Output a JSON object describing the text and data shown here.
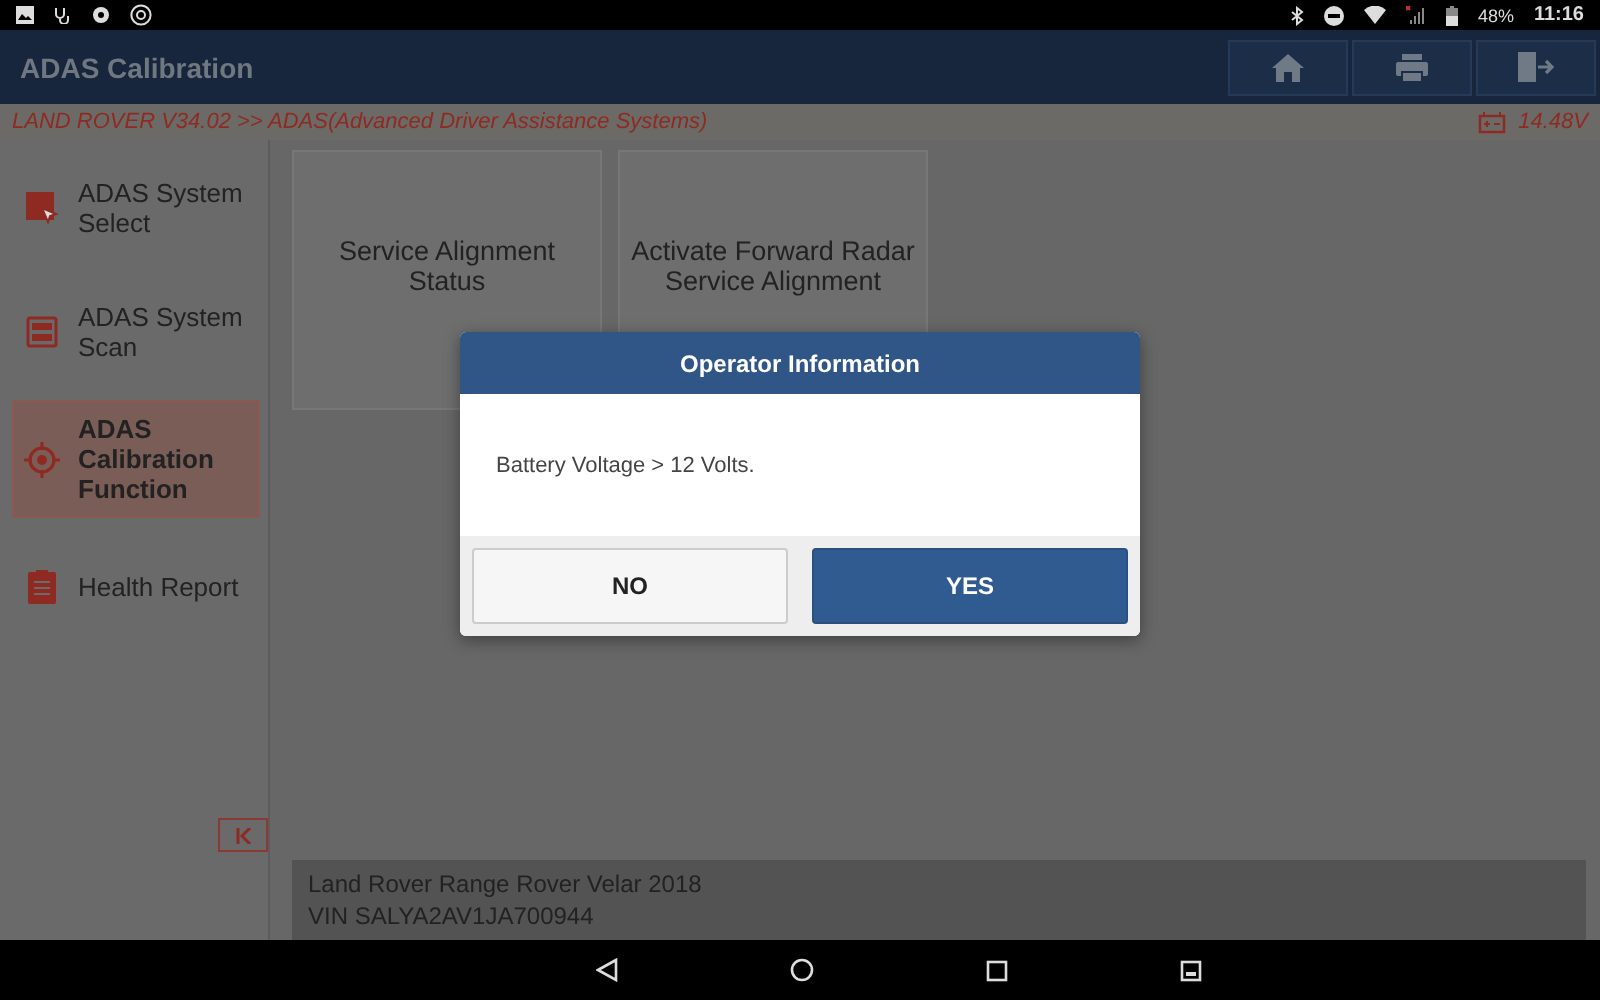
{
  "status_bar": {
    "battery": "48%",
    "time": "11:16"
  },
  "header": {
    "title": "ADAS Calibration"
  },
  "breadcrumb": {
    "path": "LAND ROVER V34.02 >> ADAS(Advanced Driver Assistance Systems)",
    "voltage": "14.48V"
  },
  "sidebar": {
    "items": [
      {
        "label": "ADAS System Select",
        "kind": "select",
        "selected": false
      },
      {
        "label": "ADAS System Scan",
        "kind": "scan",
        "selected": false
      },
      {
        "label": "ADAS Calibration Function",
        "kind": "target",
        "selected": true
      },
      {
        "label": "Health Report",
        "kind": "report",
        "selected": false
      }
    ]
  },
  "tiles": [
    "Service Alignment Status",
    "Activate Forward Radar Service Alignment"
  ],
  "vehicle": {
    "model": "Land Rover Range Rover Velar 2018",
    "vin": "VIN SALYA2AV1JA700944"
  },
  "dialog": {
    "title": "Operator Information",
    "message": "Battery Voltage > 12 Volts.",
    "buttons": [
      {
        "label": "NO",
        "kind": "secondary"
      },
      {
        "label": "YES",
        "kind": "primary"
      }
    ]
  }
}
